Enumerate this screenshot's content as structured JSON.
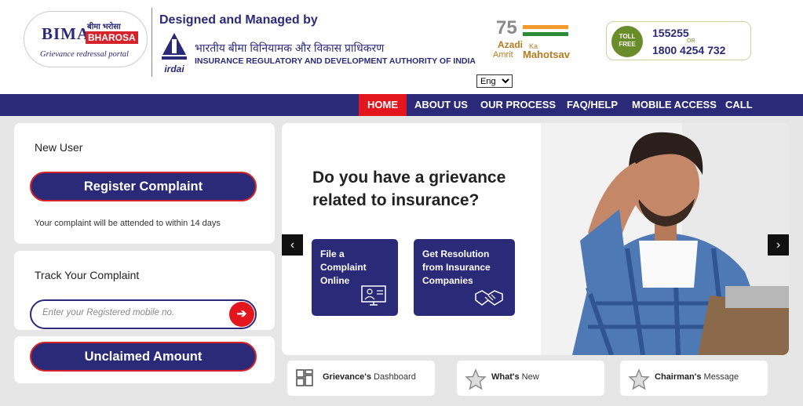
{
  "header": {
    "logo": {
      "bima": "BIMA",
      "hindi": "बीमा भरोसा",
      "bharosa": "BHAROSA",
      "tagline": "Grievance redressal portal"
    },
    "designed_by": "Designed and Managed by",
    "irdai_hindi": "भारतीय बीमा विनियामक और विकास प्राधिकरण",
    "irdai_english": "INSURANCE REGULATORY AND DEVELOPMENT AUTHORITY OF INDIA",
    "irdai_logo_text": "irdai",
    "amrit": {
      "number": "75",
      "azadi": "Azadi",
      "ka": "Ka",
      "amrit": "Amrit",
      "mahotsav": "Mahotsav"
    },
    "tollfree": {
      "label": "TOLL FREE",
      "number1": "155255",
      "or": "OR",
      "number2": "1800 4254 732"
    },
    "language": {
      "selected": "Eng"
    }
  },
  "nav": {
    "items": [
      {
        "label": "HOME",
        "active": true
      },
      {
        "label": "ABOUT US"
      },
      {
        "label": "OUR PROCESS"
      },
      {
        "label": "FAQ/HELP"
      },
      {
        "label": "MOBILE ACCESS"
      },
      {
        "label": "CALL CENTER"
      }
    ]
  },
  "new_user": {
    "title": "New User",
    "button": "Register Complaint",
    "note": "Your complaint will be attended to within 14 days"
  },
  "track": {
    "title": "Track Your Complaint",
    "placeholder": "Enter your Registered mobile no.",
    "go": "➔"
  },
  "unclaimed": {
    "button": "Unclaimed Amount"
  },
  "hero": {
    "title": "Do you have a grievance related to insurance?",
    "card1": "File a Complaint Online",
    "card2": "Get Resolution from Insurance Companies",
    "prev": "‹",
    "next": "›"
  },
  "bottom_links": [
    {
      "bold": "Grievance's",
      "rest": " Dashboard",
      "icon": "dashboard-icon"
    },
    {
      "bold": "What's",
      "rest": " New",
      "icon": "star-icon"
    },
    {
      "bold": "Chairman's",
      "rest": " Message",
      "icon": "star-icon"
    }
  ],
  "colors": {
    "primary": "#2b2a78",
    "accent": "#e3161e",
    "green": "#6a8d2a"
  }
}
